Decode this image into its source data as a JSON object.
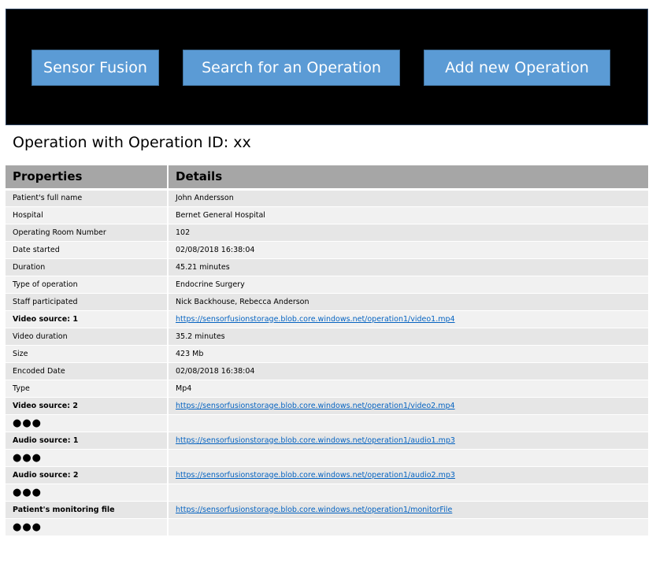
{
  "nav": {
    "sensor_fusion": "Sensor Fusion",
    "search": "Search for an Operation",
    "add_new": "Add new Operation"
  },
  "page_title": "Operation with Operation ID: xx",
  "table": {
    "headers": [
      "Properties",
      "Details"
    ],
    "rows": [
      {
        "property": "Patient's full name",
        "value": "John Andersson"
      },
      {
        "property": "Hospital",
        "value": "Bernet General Hospital"
      },
      {
        "property": "Operating Room Number",
        "value": "102"
      },
      {
        "property": "Date started",
        "value": "02/08/2018 16:38:04"
      },
      {
        "property": "Duration",
        "value": "45.21 minutes"
      },
      {
        "property": "Type of operation",
        "value": "Endocrine Surgery"
      },
      {
        "property": "Staff participated",
        "value": "Nick Backhouse, Rebecca Anderson"
      },
      {
        "property": "Video source: 1",
        "value": "https://sensorfusionstorage.blob.core.windows.net/operation1/video1.mp4"
      },
      {
        "property": "Video duration",
        "value": "35.2 minutes"
      },
      {
        "property": "Size",
        "value": "423 Mb"
      },
      {
        "property": "Encoded Date",
        "value": "02/08/2018 16:38:04"
      },
      {
        "property": "Type",
        "value": "Mp4"
      },
      {
        "property": "Video source: 2",
        "value": "https://sensorfusionstorage.blob.core.windows.net/operation1/video2.mp4"
      },
      {
        "property": "●●●",
        "value": ""
      },
      {
        "property": "Audio source: 1",
        "value": "https://sensorfusionstorage.blob.core.windows.net/operation1/audio1.mp3"
      },
      {
        "property": "●●●",
        "value": ""
      },
      {
        "property": "Audio source: 2",
        "value": "https://sensorfusionstorage.blob.core.windows.net/operation1/audio2.mp3"
      },
      {
        "property": "●●●",
        "value": ""
      },
      {
        "property": "Patient's monitoring file",
        "value": "https://sensorfusionstorage.blob.core.windows.net/operation1/monitorFile"
      },
      {
        "property": "●●●",
        "value": ""
      }
    ]
  },
  "colors": {
    "header_bg": "#000000",
    "button_bg": "#5b9bd5",
    "table_header_bg": "#a6a6a6",
    "row_odd": "#e6e6e6",
    "row_even": "#f1f1f1",
    "link": "#0563c1"
  }
}
